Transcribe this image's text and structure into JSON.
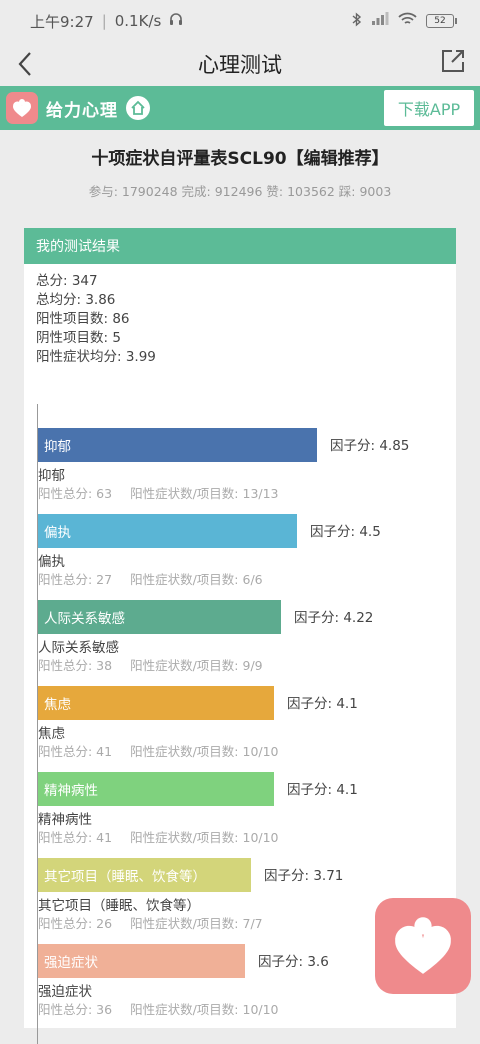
{
  "status": {
    "time": "上午9:27",
    "speed": "0.1K/s",
    "battery": "52"
  },
  "nav": {
    "title": "心理测试"
  },
  "banner": {
    "brand": "给力心理",
    "download": "下载APP"
  },
  "test": {
    "title": "十项症状自评量表SCL90【编辑推荐】",
    "stats": "参与: 1790248 完成: 912496 赞: 103562 踩: 9003"
  },
  "result": {
    "header": "我的测试结果",
    "total": "总分: 347",
    "avg": "总均分: 3.86",
    "positive_count": "阳性项目数: 86",
    "negative_count": "阴性项目数: 5",
    "positive_avg": "阳性症状均分: 3.99"
  },
  "colors": {
    "accent": "#5cbb97",
    "logo": "#ef8a8c"
  },
  "chart_data": {
    "type": "bar",
    "orientation": "horizontal",
    "categories": [
      "抑郁",
      "偏执",
      "人际关系敏感",
      "焦虑",
      "精神病性",
      "其它项目（睡眠、饮食等）",
      "强迫症状"
    ],
    "values": [
      4.85,
      4.5,
      4.22,
      4.1,
      4.1,
      3.71,
      3.6
    ],
    "value_prefix": "因子分: ",
    "colors": [
      "#4a73ad",
      "#5ab5d5",
      "#5dab8f",
      "#e6a83c",
      "#7fd27e",
      "#d3d57a",
      "#f0b097"
    ],
    "details": [
      {
        "score": "阳性总分: 63",
        "ratio": "阳性症状数/项目数: 13/13"
      },
      {
        "score": "阳性总分: 27",
        "ratio": "阳性症状数/项目数: 6/6"
      },
      {
        "score": "阳性总分: 38",
        "ratio": "阳性症状数/项目数: 9/9"
      },
      {
        "score": "阳性总分: 41",
        "ratio": "阳性症状数/项目数: 10/10"
      },
      {
        "score": "阳性总分: 41",
        "ratio": "阳性症状数/项目数: 10/10"
      },
      {
        "score": "阳性总分: 26",
        "ratio": "阳性症状数/项目数: 7/7"
      },
      {
        "score": "阳性总分: 36",
        "ratio": "阳性症状数/项目数: 10/10"
      }
    ]
  }
}
